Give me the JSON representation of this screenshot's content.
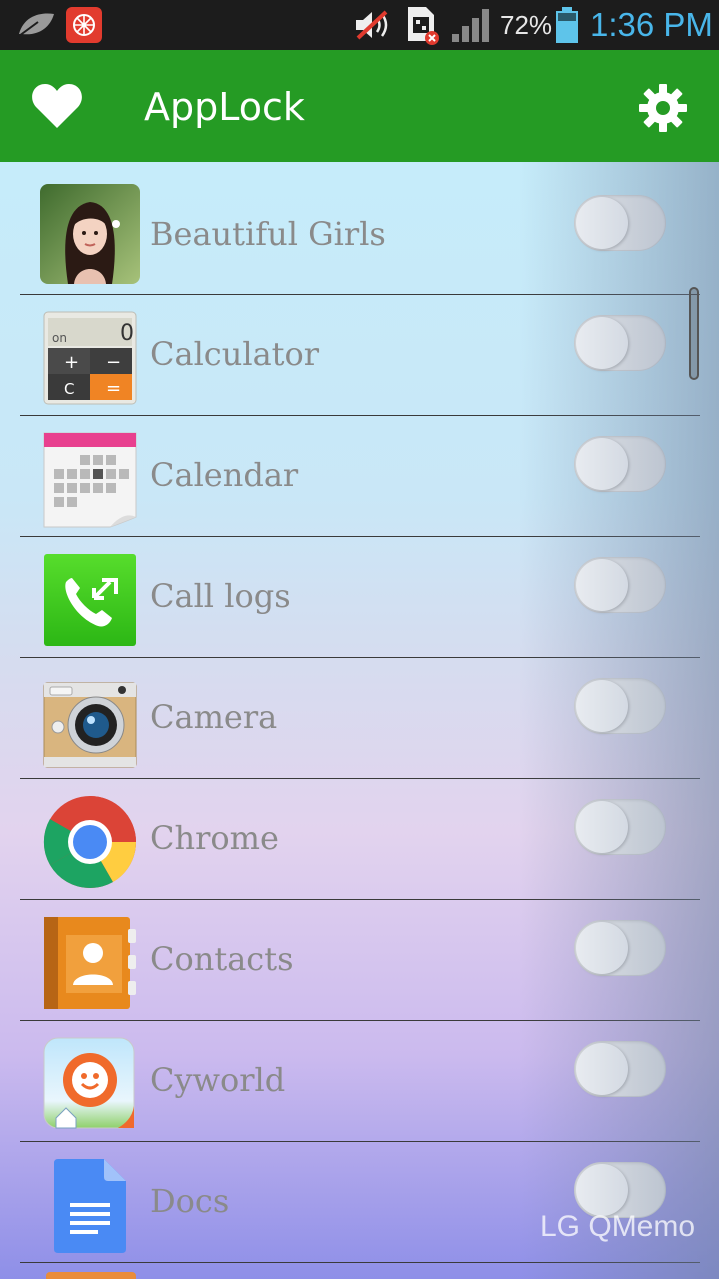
{
  "status_bar": {
    "battery_percent": "72%",
    "time": "1:36 PM",
    "icons": [
      "leaf-icon",
      "notification-app-icon",
      "volume-muted-icon",
      "sim-error-icon",
      "signal-icon",
      "battery-icon"
    ]
  },
  "action_bar": {
    "title": "AppLock",
    "color": "#259b24",
    "left_icon": "heart-icon",
    "right_icon": "gear-icon"
  },
  "apps": [
    {
      "label": "Beautiful Girls",
      "icon": "beautiful-girls-icon",
      "locked": false
    },
    {
      "label": "Calculator",
      "icon": "calculator-icon",
      "locked": false
    },
    {
      "label": "Calendar",
      "icon": "calendar-icon",
      "locked": false
    },
    {
      "label": "Call logs",
      "icon": "call-logs-icon",
      "locked": false
    },
    {
      "label": "Camera",
      "icon": "camera-icon",
      "locked": false
    },
    {
      "label": "Chrome",
      "icon": "chrome-icon",
      "locked": false
    },
    {
      "label": "Contacts",
      "icon": "contacts-icon",
      "locked": false
    },
    {
      "label": "Cyworld",
      "icon": "cyworld-icon",
      "locked": false
    },
    {
      "label": "Docs",
      "icon": "docs-icon",
      "locked": false
    }
  ],
  "watermark": "LG QMemo"
}
